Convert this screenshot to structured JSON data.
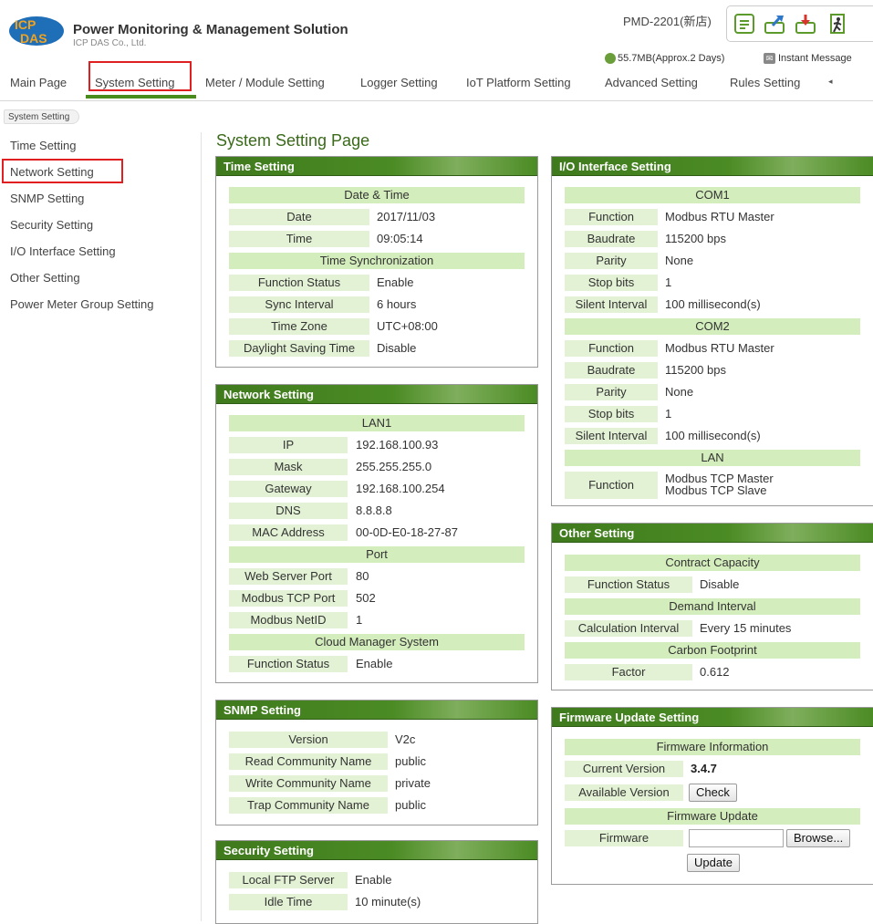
{
  "header": {
    "app_title": "Power Monitoring & Management Solution",
    "company": "ICP DAS Co., Ltd.",
    "device": "PMD-2201(新店)",
    "storage": "55.7MB(Approx.2 Days)",
    "instant_message": "Instant Message",
    "icons": [
      "document-icon",
      "upload-icon",
      "download-icon",
      "logout-icon"
    ]
  },
  "nav": {
    "items": [
      "Main Page",
      "System Setting",
      "Meter / Module Setting",
      "Logger Setting",
      "IoT Platform Setting",
      "Advanced Setting",
      "Rules Setting"
    ],
    "more": "◂",
    "active": "System Setting"
  },
  "breadcrumb": "System Setting",
  "sidebar": {
    "items": [
      "Time Setting",
      "Network Setting",
      "SNMP Setting",
      "Security Setting",
      "I/O Interface Setting",
      "Other Setting",
      "Power Meter Group Setting"
    ],
    "active": "Network Setting"
  },
  "page_title": "System Setting Page",
  "time": {
    "title": "Time Setting",
    "sec_datetime": "Date & Time",
    "date_label": "Date",
    "date_value": "2017/11/03",
    "time_label": "Time",
    "time_value": "09:05:14",
    "sec_sync": "Time Synchronization",
    "func_label": "Function Status",
    "func_value": "Enable",
    "interval_label": "Sync Interval",
    "interval_value": "6 hours",
    "zone_label": "Time Zone",
    "zone_value": "UTC+08:00",
    "dst_label": "Daylight Saving Time",
    "dst_value": "Disable"
  },
  "network": {
    "title": "Network Setting",
    "sec_lan1": "LAN1",
    "ip_label": "IP",
    "ip_value": "192.168.100.93",
    "mask_label": "Mask",
    "mask_value": "255.255.255.0",
    "gw_label": "Gateway",
    "gw_value": "192.168.100.254",
    "dns_label": "DNS",
    "dns_value": "8.8.8.8",
    "mac_label": "MAC Address",
    "mac_value": "00-0D-E0-18-27-87",
    "sec_port": "Port",
    "web_label": "Web Server Port",
    "web_value": "80",
    "mtcp_label": "Modbus TCP Port",
    "mtcp_value": "502",
    "netid_label": "Modbus NetID",
    "netid_value": "1",
    "sec_cloud": "Cloud Manager System",
    "cloud_label": "Function Status",
    "cloud_value": "Enable"
  },
  "snmp": {
    "title": "SNMP Setting",
    "version_label": "Version",
    "version_value": "V2c",
    "read_label": "Read Community Name",
    "read_value": "public",
    "write_label": "Write Community Name",
    "write_value": "private",
    "trap_label": "Trap Community Name",
    "trap_value": "public"
  },
  "security": {
    "title": "Security Setting",
    "ftp_label": "Local FTP Server",
    "ftp_value": "Enable",
    "idle_label": "Idle Time",
    "idle_value": "10 minute(s)"
  },
  "io": {
    "title": "I/O Interface Setting",
    "sec_com1": "COM1",
    "c1_func_label": "Function",
    "c1_func_value": "Modbus RTU Master",
    "c1_baud_label": "Baudrate",
    "c1_baud_value": "115200 bps",
    "c1_parity_label": "Parity",
    "c1_parity_value": "None",
    "c1_stop_label": "Stop bits",
    "c1_stop_value": "1",
    "c1_silent_label": "Silent Interval",
    "c1_silent_value": "100 millisecond(s)",
    "sec_com2": "COM2",
    "c2_func_label": "Function",
    "c2_func_value": "Modbus RTU Master",
    "c2_baud_label": "Baudrate",
    "c2_baud_value": "115200 bps",
    "c2_parity_label": "Parity",
    "c2_parity_value": "None",
    "c2_stop_label": "Stop bits",
    "c2_stop_value": "1",
    "c2_silent_label": "Silent Interval",
    "c2_silent_value": "100 millisecond(s)",
    "sec_lan": "LAN",
    "lan_func_label": "Function",
    "lan_func_value1": "Modbus TCP Master",
    "lan_func_value2": "Modbus TCP Slave"
  },
  "other": {
    "title": "Other Setting",
    "sec_contract": "Contract Capacity",
    "func_label": "Function Status",
    "func_value": "Disable",
    "sec_demand": "Demand Interval",
    "calc_label": "Calculation Interval",
    "calc_value": "Every 15 minutes",
    "sec_carbon": "Carbon Footprint",
    "factor_label": "Factor",
    "factor_value": "0.612"
  },
  "firmware": {
    "title": "Firmware Update Setting",
    "sec_info": "Firmware Information",
    "current_label": "Current Version",
    "current_value": "3.4.7",
    "available_label": "Available Version",
    "check_button": "Check",
    "sec_update": "Firmware Update",
    "firmware_label": "Firmware",
    "browse_button": "Browse...",
    "update_button": "Update"
  },
  "colors": {
    "accent": "#4a8c1c",
    "panel_header": "#3f7a1d",
    "label_bg": "#e3f2d5",
    "section_bg": "#d4edbc",
    "highlight": "#e02020"
  }
}
